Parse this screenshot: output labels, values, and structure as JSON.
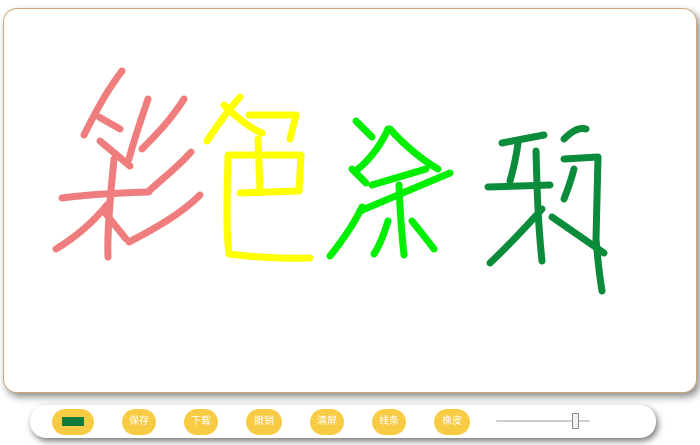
{
  "canvas": {
    "drawn_text": "彩色涂鸦",
    "stroke_colors": {
      "cai": "#f07d7d",
      "se": "#ffff00",
      "tu": "#00ee00",
      "ya": "#0b8c3a"
    }
  },
  "toolbar": {
    "current_color": "#0f7a3a",
    "save_label": "保存",
    "download_label": "下载",
    "undo_label": "撤销",
    "clear_label": "清屏",
    "line_label": "线条",
    "eraser_label": "橡皮",
    "line_width_fraction": 0.84
  },
  "colors": {
    "button_bg": "#f8cb45",
    "button_text": "#ffffff",
    "frame_border": "#cfa97a"
  }
}
